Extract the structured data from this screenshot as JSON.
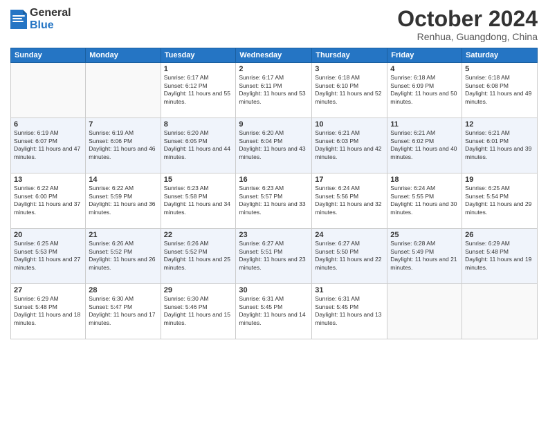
{
  "header": {
    "logo_general": "General",
    "logo_blue": "Blue",
    "month_title": "October 2024",
    "location": "Renhua, Guangdong, China"
  },
  "weekdays": [
    "Sunday",
    "Monday",
    "Tuesday",
    "Wednesday",
    "Thursday",
    "Friday",
    "Saturday"
  ],
  "weeks": [
    [
      {
        "day": "",
        "info": ""
      },
      {
        "day": "",
        "info": ""
      },
      {
        "day": "1",
        "info": "Sunrise: 6:17 AM\nSunset: 6:12 PM\nDaylight: 11 hours and 55 minutes."
      },
      {
        "day": "2",
        "info": "Sunrise: 6:17 AM\nSunset: 6:11 PM\nDaylight: 11 hours and 53 minutes."
      },
      {
        "day": "3",
        "info": "Sunrise: 6:18 AM\nSunset: 6:10 PM\nDaylight: 11 hours and 52 minutes."
      },
      {
        "day": "4",
        "info": "Sunrise: 6:18 AM\nSunset: 6:09 PM\nDaylight: 11 hours and 50 minutes."
      },
      {
        "day": "5",
        "info": "Sunrise: 6:18 AM\nSunset: 6:08 PM\nDaylight: 11 hours and 49 minutes."
      }
    ],
    [
      {
        "day": "6",
        "info": "Sunrise: 6:19 AM\nSunset: 6:07 PM\nDaylight: 11 hours and 47 minutes."
      },
      {
        "day": "7",
        "info": "Sunrise: 6:19 AM\nSunset: 6:06 PM\nDaylight: 11 hours and 46 minutes."
      },
      {
        "day": "8",
        "info": "Sunrise: 6:20 AM\nSunset: 6:05 PM\nDaylight: 11 hours and 44 minutes."
      },
      {
        "day": "9",
        "info": "Sunrise: 6:20 AM\nSunset: 6:04 PM\nDaylight: 11 hours and 43 minutes."
      },
      {
        "day": "10",
        "info": "Sunrise: 6:21 AM\nSunset: 6:03 PM\nDaylight: 11 hours and 42 minutes."
      },
      {
        "day": "11",
        "info": "Sunrise: 6:21 AM\nSunset: 6:02 PM\nDaylight: 11 hours and 40 minutes."
      },
      {
        "day": "12",
        "info": "Sunrise: 6:21 AM\nSunset: 6:01 PM\nDaylight: 11 hours and 39 minutes."
      }
    ],
    [
      {
        "day": "13",
        "info": "Sunrise: 6:22 AM\nSunset: 6:00 PM\nDaylight: 11 hours and 37 minutes."
      },
      {
        "day": "14",
        "info": "Sunrise: 6:22 AM\nSunset: 5:59 PM\nDaylight: 11 hours and 36 minutes."
      },
      {
        "day": "15",
        "info": "Sunrise: 6:23 AM\nSunset: 5:58 PM\nDaylight: 11 hours and 34 minutes."
      },
      {
        "day": "16",
        "info": "Sunrise: 6:23 AM\nSunset: 5:57 PM\nDaylight: 11 hours and 33 minutes."
      },
      {
        "day": "17",
        "info": "Sunrise: 6:24 AM\nSunset: 5:56 PM\nDaylight: 11 hours and 32 minutes."
      },
      {
        "day": "18",
        "info": "Sunrise: 6:24 AM\nSunset: 5:55 PM\nDaylight: 11 hours and 30 minutes."
      },
      {
        "day": "19",
        "info": "Sunrise: 6:25 AM\nSunset: 5:54 PM\nDaylight: 11 hours and 29 minutes."
      }
    ],
    [
      {
        "day": "20",
        "info": "Sunrise: 6:25 AM\nSunset: 5:53 PM\nDaylight: 11 hours and 27 minutes."
      },
      {
        "day": "21",
        "info": "Sunrise: 6:26 AM\nSunset: 5:52 PM\nDaylight: 11 hours and 26 minutes."
      },
      {
        "day": "22",
        "info": "Sunrise: 6:26 AM\nSunset: 5:52 PM\nDaylight: 11 hours and 25 minutes."
      },
      {
        "day": "23",
        "info": "Sunrise: 6:27 AM\nSunset: 5:51 PM\nDaylight: 11 hours and 23 minutes."
      },
      {
        "day": "24",
        "info": "Sunrise: 6:27 AM\nSunset: 5:50 PM\nDaylight: 11 hours and 22 minutes."
      },
      {
        "day": "25",
        "info": "Sunrise: 6:28 AM\nSunset: 5:49 PM\nDaylight: 11 hours and 21 minutes."
      },
      {
        "day": "26",
        "info": "Sunrise: 6:29 AM\nSunset: 5:48 PM\nDaylight: 11 hours and 19 minutes."
      }
    ],
    [
      {
        "day": "27",
        "info": "Sunrise: 6:29 AM\nSunset: 5:48 PM\nDaylight: 11 hours and 18 minutes."
      },
      {
        "day": "28",
        "info": "Sunrise: 6:30 AM\nSunset: 5:47 PM\nDaylight: 11 hours and 17 minutes."
      },
      {
        "day": "29",
        "info": "Sunrise: 6:30 AM\nSunset: 5:46 PM\nDaylight: 11 hours and 15 minutes."
      },
      {
        "day": "30",
        "info": "Sunrise: 6:31 AM\nSunset: 5:45 PM\nDaylight: 11 hours and 14 minutes."
      },
      {
        "day": "31",
        "info": "Sunrise: 6:31 AM\nSunset: 5:45 PM\nDaylight: 11 hours and 13 minutes."
      },
      {
        "day": "",
        "info": ""
      },
      {
        "day": "",
        "info": ""
      }
    ]
  ]
}
